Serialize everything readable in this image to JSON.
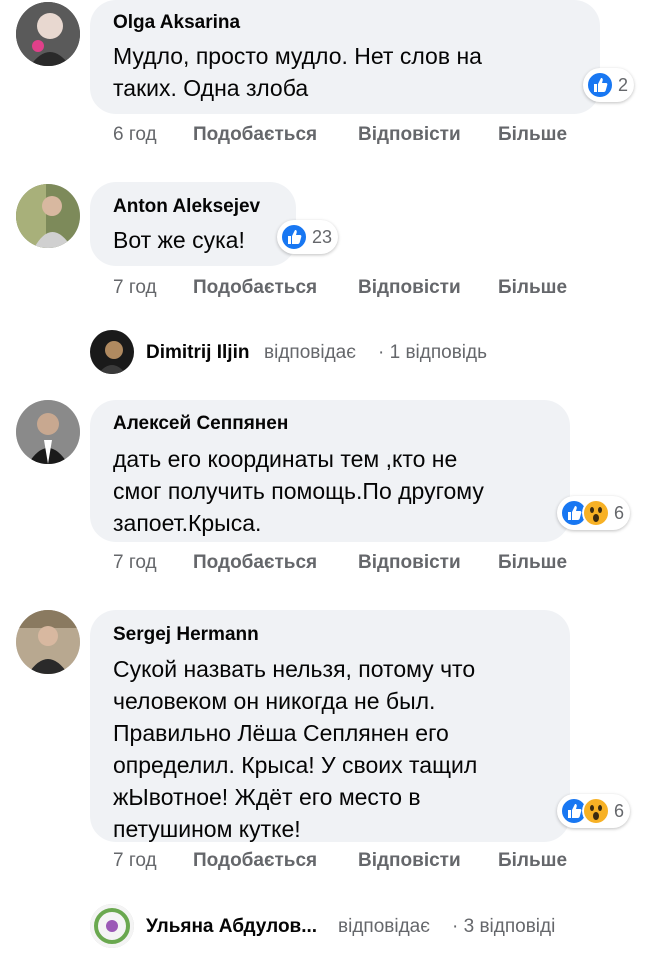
{
  "comments": [
    {
      "author": "Olga Aksarina",
      "text": "Мудло, просто мудло. Нет слов на\nтаких. Одна злоба",
      "reaction_count": "2",
      "time": "6 год",
      "like": "Подобається",
      "reply": "Відповісти",
      "more": "Більше"
    },
    {
      "author": "Anton Aleksejev",
      "text": "Вот же сука!",
      "reaction_count": "23",
      "time": "7 год",
      "like": "Подобається",
      "reply": "Відповісти",
      "more": "Більше"
    },
    {
      "author": "Алексей Сеппянен",
      "text": "дать его координаты тем ,кто не\nсмог получить помощь.По другому\nзапоет.Крыса.",
      "reaction_count": "6",
      "time": "7 год",
      "like": "Подобається",
      "reply": "Відповісти",
      "more": "Більше"
    },
    {
      "author": "Sergej Hermann",
      "text": "Сукой назвать нельзя, потому что\nчеловеком он никогда не был.\nПравильно Лёша Сеплянен его\nопределил. Крыса! У своих тащил\nжЫвотное! Ждёт его место в\nпетушином кутке!",
      "reaction_count": "6",
      "time": "7 год",
      "like": "Подобається",
      "reply": "Відповісти",
      "more": "Більше"
    }
  ],
  "replies": [
    {
      "name": "Dimitrij Iljin",
      "verb": "відповідає",
      "count": "· 1 відповідь"
    },
    {
      "name": "Ульяна Абдулов...",
      "verb": "відповідає",
      "count": "· 3 відповіді"
    }
  ],
  "colors": {
    "bubble": "#f0f2f5",
    "like_blue": "#1877f2",
    "wow_yellow": "#f7b125",
    "meta_gray": "#65676b"
  }
}
